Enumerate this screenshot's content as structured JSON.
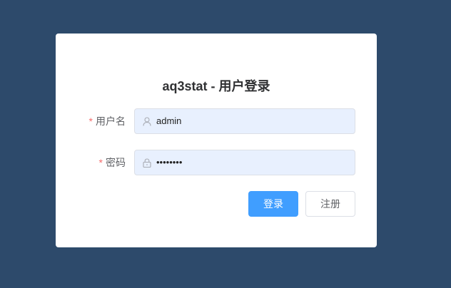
{
  "page": {
    "background_color": "#2d4a6b"
  },
  "login": {
    "title": "aq3stat - 用户登录",
    "username": {
      "required_mark": "*",
      "label": "用户名",
      "value": "admin",
      "icon": "user-icon"
    },
    "password": {
      "required_mark": "*",
      "label": "密码",
      "value": "••••••••",
      "icon": "lock-icon"
    },
    "buttons": {
      "login_label": "登录",
      "register_label": "注册"
    },
    "colors": {
      "primary": "#409eff",
      "required": "#f56c6c",
      "input_bg": "#e8f0fe"
    }
  }
}
